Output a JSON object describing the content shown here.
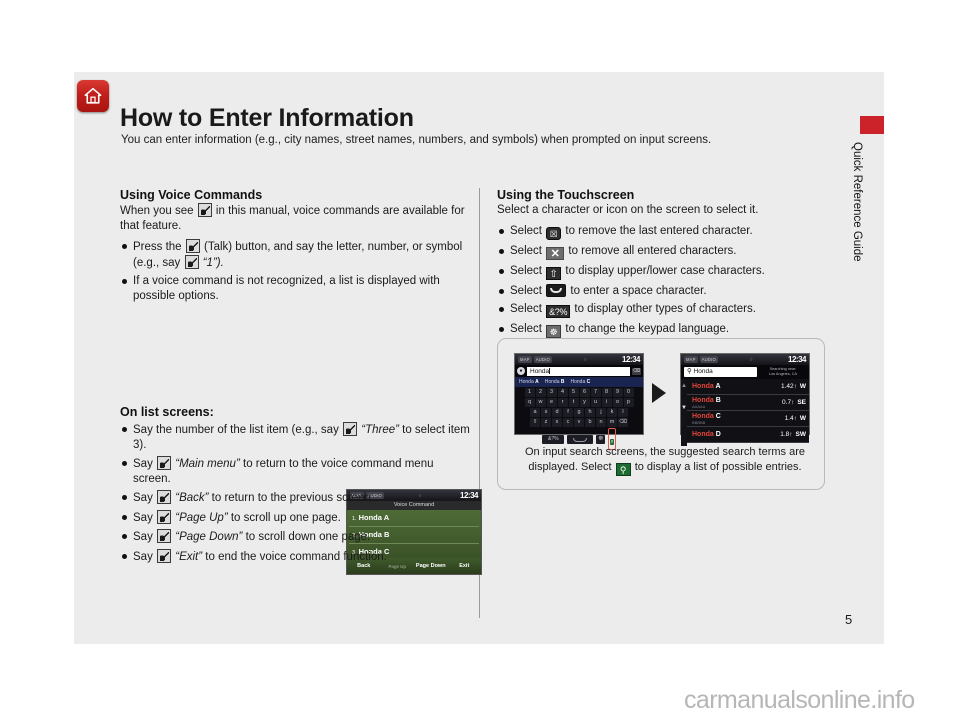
{
  "header": {
    "home_icon": "home-icon",
    "title": "How to Enter Information",
    "subtitle": "You can enter information (e.g., city names, street names, numbers, and symbols) when prompted on input screens.",
    "side_label": "Quick Reference Guide",
    "tab_color": "#cc2229"
  },
  "left_column": {
    "heading": "Using Voice Commands",
    "lead_a": "When you see",
    "lead_b": "in this manual, voice commands are available for that feature.",
    "bullets": [
      {
        "a": "Press the",
        "b": "(Talk) button, and say the letter, number, or symbol (e.g., say",
        "c": "“1”)."
      },
      {
        "a": "If a voice command is not recognized, a list is displayed with possible options."
      }
    ],
    "subheading": "On list screens:",
    "list_bullets": [
      {
        "a": "Say the number of the list item (e.g., say",
        "q": "“Three”",
        "b": "to select item 3)."
      },
      {
        "a": "Say",
        "q": "“Main menu”",
        "b": "to return to the voice command menu screen."
      },
      {
        "a": "Say",
        "q": "“Back”",
        "b": "to return to the previous screen."
      },
      {
        "a": "Say",
        "q": "“Page Up”",
        "b": "to scroll up one page."
      },
      {
        "a": "Say",
        "q": "“Page Down”",
        "b": "to scroll down one page."
      },
      {
        "a": "Say",
        "q": "“Exit”",
        "b": "to end the voice command function."
      }
    ]
  },
  "voice_screenshot": {
    "status_map": "MAP",
    "status_audio": "AUDIO",
    "status_dot": "○",
    "clock": "12:34",
    "title": "Voice Command",
    "rows": [
      {
        "num": "1.",
        "label": "Honda A"
      },
      {
        "num": "2.",
        "label": "Honda B"
      },
      {
        "num": "3.",
        "label": "Honda C"
      }
    ],
    "footer": [
      "Back",
      "Page Up",
      "Page Down",
      "Exit"
    ]
  },
  "right_column": {
    "heading": "Using the Touchscreen",
    "lead": "Select a character or icon on the screen to select it.",
    "bullets": [
      {
        "pre": "Select",
        "icon": "delete-character-icon",
        "glyph": "☒",
        "post": "to remove the last entered character."
      },
      {
        "pre": "Select",
        "icon": "clear-all-icon",
        "glyph": "✕",
        "post": "to remove all entered characters."
      },
      {
        "pre": "Select",
        "icon": "shift-case-icon",
        "glyph": "⇧",
        "post": "to display upper/lower case characters."
      },
      {
        "pre": "Select",
        "icon": "space-bar-icon",
        "glyph": "",
        "post": "to enter a space character."
      },
      {
        "pre": "Select",
        "icon": "symbols-icon",
        "glyph": "&?%",
        "post": "to display other types of characters."
      },
      {
        "pre": "Select",
        "icon": "keypad-language-icon",
        "glyph": "☸",
        "post": "to change the keypad language."
      }
    ]
  },
  "figure": {
    "caption_a": "On input search screens, the suggested search terms are displayed. Select",
    "caption_icon": "search-icon",
    "caption_b": "to display a list of possible entries.",
    "keyboard_screen": {
      "status_map": "MAP",
      "status_audio": "AUDIO",
      "clock": "12:34",
      "search_value": "Honda",
      "search_prefix_icon": "location-pin-icon",
      "clear_icon": "backspace-icon",
      "suggestions": [
        {
          "base": "Honda ",
          "bold": "A"
        },
        {
          "base": "Honda ",
          "bold": "B"
        },
        {
          "base": "Honda ",
          "bold": "C"
        }
      ],
      "rows": [
        [
          "1",
          "2",
          "3",
          "4",
          "5",
          "6",
          "7",
          "8",
          "9",
          "0"
        ],
        [
          "q",
          "w",
          "e",
          "r",
          "t",
          "y",
          "u",
          "i",
          "o",
          "p"
        ],
        [
          "a",
          "s",
          "d",
          "f",
          "g",
          "h",
          "j",
          "k",
          "l"
        ],
        [
          "⇧",
          "z",
          "x",
          "c",
          "v",
          "b",
          "n",
          "m",
          "⌫"
        ]
      ],
      "symbols_key": "&?%",
      "space_key": "space-bar-icon",
      "globe_key": "keypad-language-icon",
      "go_key": "search-icon",
      "go_glyph": "⌕"
    },
    "list_screen": {
      "status_map": "MAP",
      "status_audio": "AUDIO",
      "clock": "12:34",
      "search_value": "Honda",
      "search_icon": "search-icon",
      "near_label_line1": "Searching near:",
      "near_label_line2": "Los Angeles, CA",
      "scroll_up_icon": "scroll-up-icon",
      "scroll_down_icon": "scroll-down-icon",
      "results": [
        {
          "base": "Honda ",
          "bold": "A",
          "sub": "",
          "dist": "1.42↑",
          "dir": "W"
        },
        {
          "base": "Honda ",
          "bold": "B",
          "sub": "AAAAA",
          "dist": "0.7↑",
          "dir": "SE"
        },
        {
          "base": "Honda ",
          "bold": "C",
          "sub": "BBBBB",
          "dist": "1.4↑",
          "dir": "W"
        },
        {
          "base": "Honda ",
          "bold": "D",
          "sub": "",
          "dist": "1.8↑",
          "dir": "SW"
        }
      ]
    }
  },
  "footer": {
    "page_number": "5",
    "watermark": "carmanualsonline.info"
  }
}
